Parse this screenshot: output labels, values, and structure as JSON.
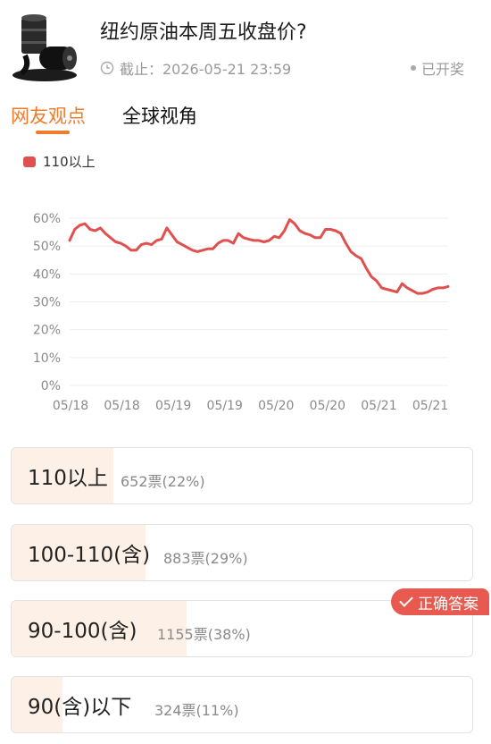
{
  "header": {
    "title": "纽约原油本周五收盘价?",
    "deadline": "截止：2026-05-21 23:59",
    "status": "已开奖",
    "thumbnail_icon": "oil-barrel-icon"
  },
  "tabs": [
    {
      "label": "网友观点"
    },
    {
      "label": "全球视角"
    }
  ],
  "chart_legend": "110以上",
  "colors": {
    "accent": "#f07b2b",
    "line": "#e0504f",
    "fill": "#fdf1e7",
    "badge": "#e85a4f"
  },
  "chart_data": {
    "type": "line",
    "series": [
      {
        "name": "110以上",
        "values": [
          52,
          56,
          57.5,
          58,
          56,
          55.5,
          56.5,
          54.5,
          53,
          51.5,
          51,
          50,
          48.5,
          48.5,
          50.5,
          51,
          50.5,
          52,
          52.5,
          56.5,
          54,
          51.5,
          50.5,
          49.5,
          48.5,
          48,
          48.5,
          49,
          49,
          51,
          52,
          52,
          51,
          54.5,
          53,
          52.5,
          52,
          52,
          51.5,
          52,
          53.5,
          53,
          55.5,
          59.5,
          58,
          55.5,
          54.5,
          54,
          53,
          53,
          56,
          56,
          55.5,
          54.5,
          51,
          48,
          46.5,
          45.5,
          42,
          39,
          37.5,
          35,
          34.5,
          34,
          33.5,
          36.5,
          35,
          34,
          33,
          33,
          33.5,
          34.5,
          35,
          35,
          35.5
        ]
      }
    ],
    "x_tick_labels": [
      "05/18",
      "05/18",
      "05/19",
      "05/19",
      "05/20",
      "05/20",
      "05/21",
      "05/21"
    ],
    "y_tick_labels": [
      "0%",
      "10%",
      "20%",
      "30%",
      "40%",
      "50%",
      "60%"
    ],
    "ylim": [
      0,
      60
    ],
    "grid": true,
    "legend_position": "top-left"
  },
  "options": [
    {
      "label": "110以上",
      "votes": "652票(22%)",
      "percent": 22
    },
    {
      "label": "100-110(含)",
      "votes": "883票(29%)",
      "percent": 29
    },
    {
      "label": "90-100(含)",
      "votes": "1155票(38%)",
      "percent": 38
    },
    {
      "label": "90(含)以下",
      "votes": "324票(11%)",
      "percent": 11
    }
  ],
  "correct_badge": "正确答案"
}
